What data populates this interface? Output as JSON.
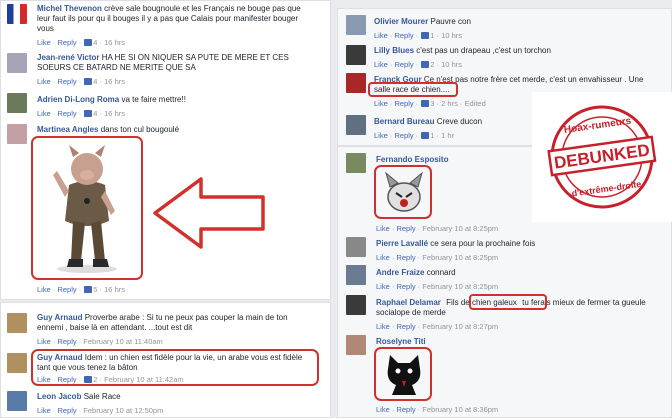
{
  "left_top": {
    "c1": {
      "name": "Michel Thevenon",
      "line1": "crève sale bougnoule et les Français ne bouge pas que",
      "line2": "leur faut ils pour qu il bouges il y a pas que Calais pour manifester bouger",
      "line3": "vous",
      "likes": "4",
      "time": "16 hrs"
    },
    "c2": {
      "name": "Jean-rené Victor",
      "line1": "HA HE SI ON NIQUER SA PUTE DE MERE ET CES",
      "line2": "SOEURS CE BATARD NE MERITE QUE SA",
      "likes": "4",
      "time": "16 hrs"
    },
    "c3": {
      "name": "Adrien Di-Long Roma",
      "text": "va te faire mettre!!",
      "likes": "4",
      "time": "16 hrs"
    },
    "c4": {
      "name": "Martinea Angles",
      "text": "dans ton cul bougoulé",
      "likes": "5",
      "time": "16 hrs"
    }
  },
  "left_bottom": {
    "c1": {
      "name": "Guy Arnaud",
      "line1": "Proverbe arabe : Si tu ne peux pas couper la main de ton",
      "line2": "ennemi , baise là en attendant. ...tout est dit",
      "time": "February 10 at 11:40am"
    },
    "c2": {
      "name": "Guy Arnaud",
      "line1": "Idem : un chien est fidèle pour la vie, un arabe vous est fidèle",
      "line2": "tant que vous tenez la bâton",
      "likes": "2",
      "time": "February 10 at 11:42am"
    },
    "c3": {
      "name": "Leon Jacob",
      "text": "Sale Race",
      "time": "February 10 at 12:50pm"
    }
  },
  "right_top": {
    "c1": {
      "name": "Olivier Mourer",
      "text": "Pauvre con",
      "likes": "1",
      "time": "10 hrs"
    },
    "c2": {
      "name": "Lilly Blues",
      "text": "c'est pas un drapeau ,c'est un torchon",
      "likes": "2",
      "time": "10 hrs"
    },
    "c3": {
      "name": "Franck Gour",
      "line1": "Ce n'est pas notre frère cet merde, c'est un envahisseur . Une",
      "line2": "salle race de chien....",
      "likes": "3",
      "time": "2 hrs",
      "edited": "Edited"
    },
    "c4": {
      "name": "Bernard Bureau",
      "text": "Creve ducon",
      "likes": "1",
      "time": "1 hr"
    }
  },
  "right_bottom": {
    "c1": {
      "name": "Fernando Esposito",
      "time": "February 10 at 8:25pm"
    },
    "c2": {
      "name": "Pierre Lavallé",
      "text": "ce sera pour la prochaine fois",
      "time": "February 10 at 8:25pm"
    },
    "c3": {
      "name": "Andre Fraize",
      "text": "connard",
      "time": "February 10 at 8:25pm"
    },
    "c4": {
      "name": "Raphael Delamar",
      "line1": "Fils de chien galeux",
      "line1b": "tu ferais mieux de fermer ta gueule",
      "line2": "socialope de merde",
      "time": "February 10 at 8:27pm"
    },
    "c5": {
      "name": "Roselyne Titi",
      "time": "February 10 at 8:36pm"
    }
  },
  "ui": {
    "like": "Like",
    "reply": "Reply",
    "dot": "·"
  },
  "stamp": {
    "top": "Hoax-rumeurs",
    "middle": "DEBUNKED",
    "bottom": "d'extrême-droite"
  },
  "colors": {
    "annotation_red": "#d0312d",
    "link_blue": "#365899",
    "stamp_red": "#c8202a"
  }
}
